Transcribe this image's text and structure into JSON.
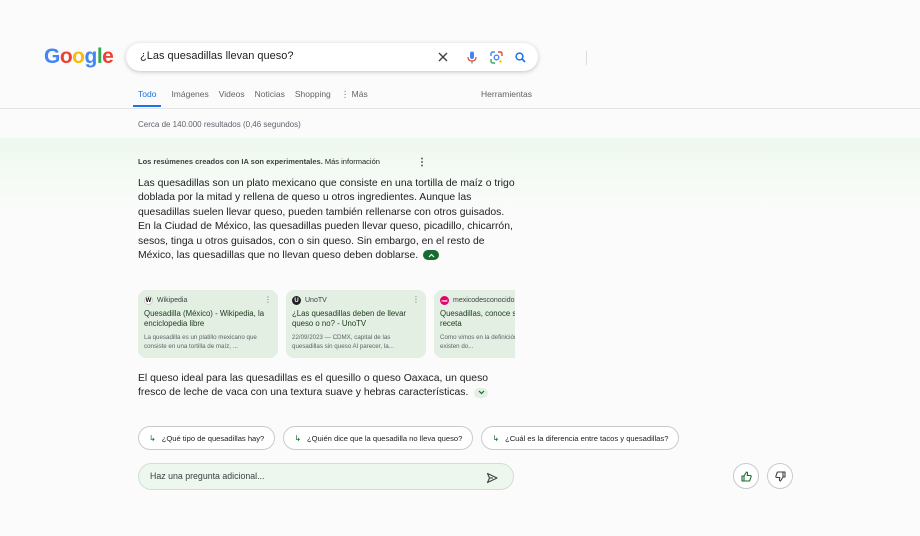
{
  "logo": {
    "letters": [
      {
        "ch": "G",
        "color": "#4285F4"
      },
      {
        "ch": "o",
        "color": "#EA4335"
      },
      {
        "ch": "o",
        "color": "#FBBC05"
      },
      {
        "ch": "g",
        "color": "#4285F4"
      },
      {
        "ch": "l",
        "color": "#34A853"
      },
      {
        "ch": "e",
        "color": "#EA4335"
      }
    ]
  },
  "search": {
    "query": "¿Las quesadillas llevan queso?"
  },
  "tabs": [
    "Todo",
    "Imágenes",
    "Videos",
    "Noticias",
    "Shopping",
    "⋮ Más"
  ],
  "tools": "Herramientas",
  "result_count": "Cerca de 140.000 resultados (0,46 segundos)",
  "ai": {
    "note": "Los resúmenes creados con IA son experimentales.",
    "more_info": "Más información",
    "paragraph": "Las quesadillas son un plato mexicano que consiste en una tortilla de maíz o trigo doblada por la mitad y rellena de queso u otros ingredientes. Aunque las quesadillas suelen llevar queso, pueden también rellenarse con otros guisados. En la Ciudad de México, las quesadillas pueden llevar queso, picadillo, chicarrón, sesos, tinga u otros guisados, con o sin queso. Sin embargo, en el resto de México, las quesadillas que no llevan queso deben doblarse.",
    "sources": [
      {
        "site": "Wikipedia",
        "favicon": "W",
        "favicon_color": "#ffffff",
        "title": "Quesadilla (México) - Wikipedia, la enciclopedia libre",
        "snippet": "La quesadilla es un platillo mexicano que consiste en una tortilla de maíz, ..."
      },
      {
        "site": "UnoTV",
        "favicon": "U",
        "favicon_color": "#202124",
        "title": "¿Las quesadillas deben de llevar queso o no? - UnoTV",
        "snippet": "22/09/2023 — CDMX, capital de las quesadillas sin queso Al parecer, la..."
      },
      {
        "site": "mexicodesconocido",
        "favicon": "md",
        "favicon_color": "#e5006d",
        "title": "Quesadillas, conoce su historia y su receta",
        "snippet": "Como vimos en la definición del Diccionario, existen do..."
      }
    ],
    "paragraph2": "El queso ideal para las quesadillas es el quesillo o queso Oaxaca, un queso fresco de leche de vaca con una textura suave y hebras características.",
    "followups": [
      "¿Qué tipo de quesadillas hay?",
      "¿Quién dice que la quesadilla no lleva queso?",
      "¿Cuál es la diferencia entre tacos y quesadillas?"
    ],
    "ask_placeholder": "Haz una pregunta adicional..."
  },
  "colors": {
    "accent": "#1a73e8",
    "ai_green": "#146c2e"
  }
}
